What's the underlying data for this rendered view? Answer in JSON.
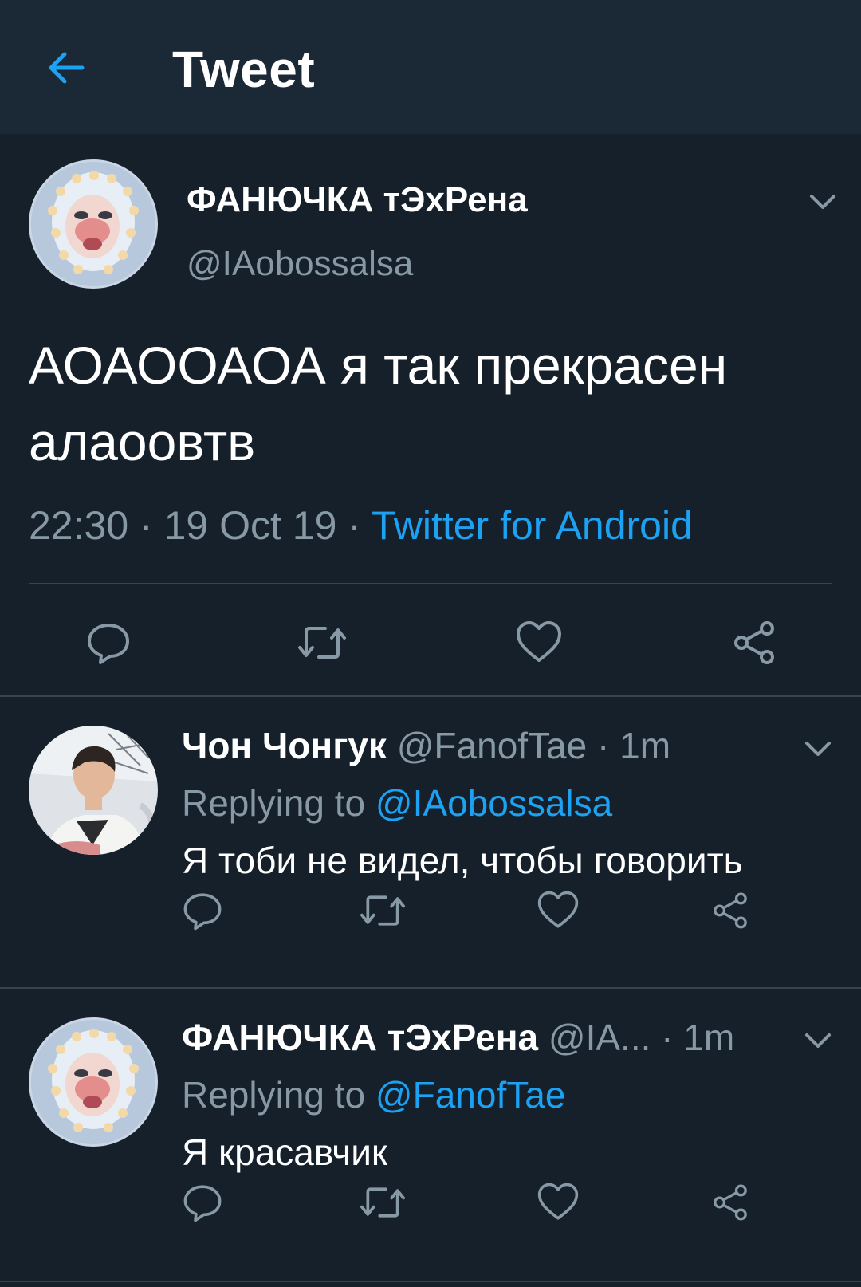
{
  "header": {
    "title": "Tweet",
    "back_icon": "arrow-left-icon"
  },
  "colors": {
    "background": "#15202b",
    "header": "#1b2836",
    "accent": "#1da1f2",
    "muted": "#8899a6",
    "divider": "#38444d"
  },
  "main_tweet": {
    "display_name": "ФАНЮЧКА тЭхРена",
    "handle": "@IAobossalsa",
    "text": "АОАООАОА я так прекрасен алаоовтв",
    "time": "22:30",
    "date": "19 Oct 19",
    "separator": "·",
    "source": "Twitter for Android",
    "actions": [
      "reply-icon",
      "retweet-icon",
      "like-icon",
      "share-icon"
    ]
  },
  "replies": [
    {
      "display_name": "Чон Чонгук",
      "handle": "@FanofTae",
      "separator": "·",
      "time": "1m",
      "replying_prefix": "Replying to",
      "replying_to": "@IAobossalsa",
      "text": "Я тоби не видел, чтобы говорить"
    },
    {
      "display_name": "ФАНЮЧКА тЭхРена",
      "handle": "@IA...",
      "separator": "·",
      "time": "1m",
      "replying_prefix": "Replying to",
      "replying_to": "@FanofTae",
      "text": "Я красавчик"
    }
  ]
}
